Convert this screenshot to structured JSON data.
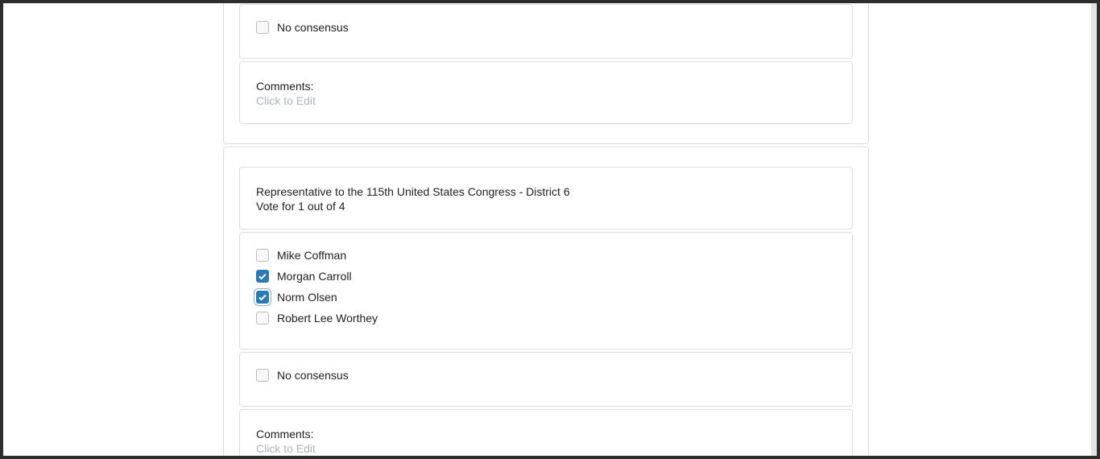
{
  "prev_race": {
    "no_consensus": "No consensus",
    "comments_label": "Comments:",
    "comments_placeholder": "Click to Edit"
  },
  "race": {
    "title": "Representative to the 115th United States Congress - District 6",
    "instructions": "Vote for 1 out of 4",
    "candidates": [
      {
        "name": "Mike Coffman",
        "checked": false
      },
      {
        "name": "Morgan Carroll",
        "checked": true
      },
      {
        "name": "Norm Olsen",
        "checked": true,
        "focused": true
      },
      {
        "name": "Robert Lee Worthey",
        "checked": false
      }
    ],
    "no_consensus": "No consensus",
    "comments_label": "Comments:",
    "comments_placeholder": "Click to Edit"
  },
  "colors": {
    "checkbox_checked": "#2a7ab8"
  }
}
